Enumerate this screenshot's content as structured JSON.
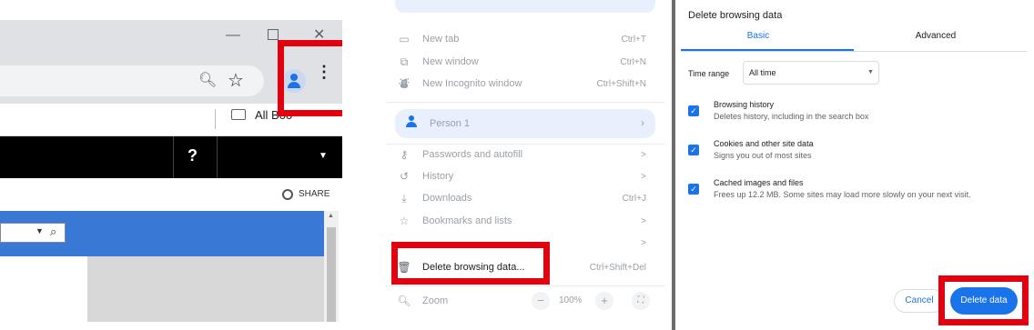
{
  "panel1": {
    "bookmarks_label": "All Boo",
    "help_label": "?",
    "share_label": "SHARE",
    "icons": {
      "minimize": "minimize-icon",
      "maximize": "maximize-icon",
      "close": "close-icon",
      "zoom": "zoom-icon",
      "star": "star-icon",
      "profile": "profile-icon",
      "kebab": "kebab-menu-icon",
      "folder": "folder-icon",
      "search": "search-icon"
    }
  },
  "panel2": {
    "items": [
      {
        "label": "New tab",
        "shortcut": "Ctrl+T"
      },
      {
        "label": "New window",
        "shortcut": "Ctrl+N"
      },
      {
        "label": "New Incognito window",
        "shortcut": "Ctrl+Shift+N"
      }
    ],
    "person_label": "Person 1",
    "items2": [
      {
        "label": "Passwords and autofill",
        "shortcut": ">"
      },
      {
        "label": "History",
        "shortcut": ">"
      },
      {
        "label": "Downloads",
        "shortcut": "Ctrl+J"
      },
      {
        "label": "Bookmarks and lists",
        "shortcut": ">"
      },
      {
        "label": "",
        "shortcut": ">"
      }
    ],
    "delete_label": "Delete browsing data...",
    "delete_shortcut": "Ctrl+Shift+Del",
    "zoom_label": "Zoom",
    "zoom_value": "100%"
  },
  "panel3": {
    "title": "Delete browsing data",
    "tabs": [
      "Basic",
      "Advanced"
    ],
    "time_range_label": "Time range",
    "time_range_value": "All time",
    "items": [
      {
        "title": "Browsing history",
        "desc": "Deletes history, including in the search box"
      },
      {
        "title": "Cookies and other site data",
        "desc": "Signs you out of most sites"
      },
      {
        "title": "Cached images and files",
        "desc": "Frees up 12.2 MB. Some sites may load more slowly on your next visit."
      }
    ],
    "cancel_label": "Cancel",
    "delete_label": "Delete data"
  },
  "colors": {
    "highlight": "#e3000f",
    "primary": "#1a73e8",
    "menu_bg_highlight": "#e8f0fe"
  }
}
